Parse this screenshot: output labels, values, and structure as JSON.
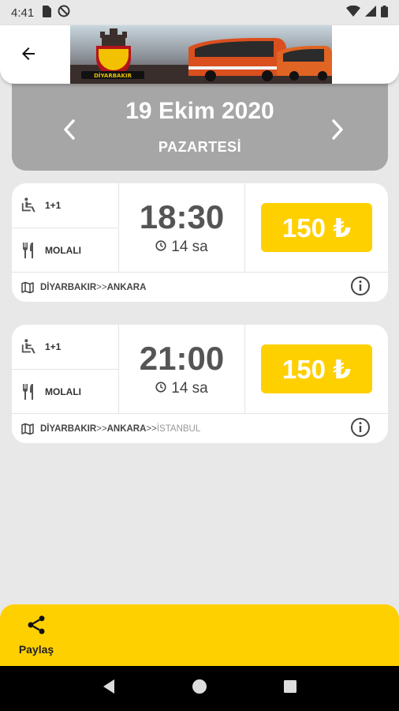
{
  "status_bar": {
    "time": "4:41"
  },
  "header": {
    "back_icon": "arrow-left-icon",
    "banner_logo_text": "DİYARBAKIR"
  },
  "date_selector": {
    "date": "19 Ekim 2020",
    "day": "PAZARTESİ"
  },
  "trips": [
    {
      "seat_layout": "1+1",
      "break_label": "MOLALI",
      "departure_time": "18:30",
      "duration": "14 sa",
      "price": "150 ₺",
      "route": {
        "from": "DİYARBAKIR",
        "separator": ">>",
        "to": "ANKARA"
      }
    },
    {
      "seat_layout": "1+1",
      "break_label": "MOLALI",
      "departure_time": "21:00",
      "duration": "14 sa",
      "price": "150 ₺",
      "route": {
        "from": "DİYARBAKIR",
        "separator": ">>",
        "to": "ANKARA",
        "separator2": ">>",
        "via": "İSTANBUL"
      }
    }
  ],
  "share": {
    "label": "Paylaş"
  },
  "colors": {
    "accent": "#ffd000",
    "date_card": "#a6a6a6",
    "background": "#e8e8e8"
  }
}
